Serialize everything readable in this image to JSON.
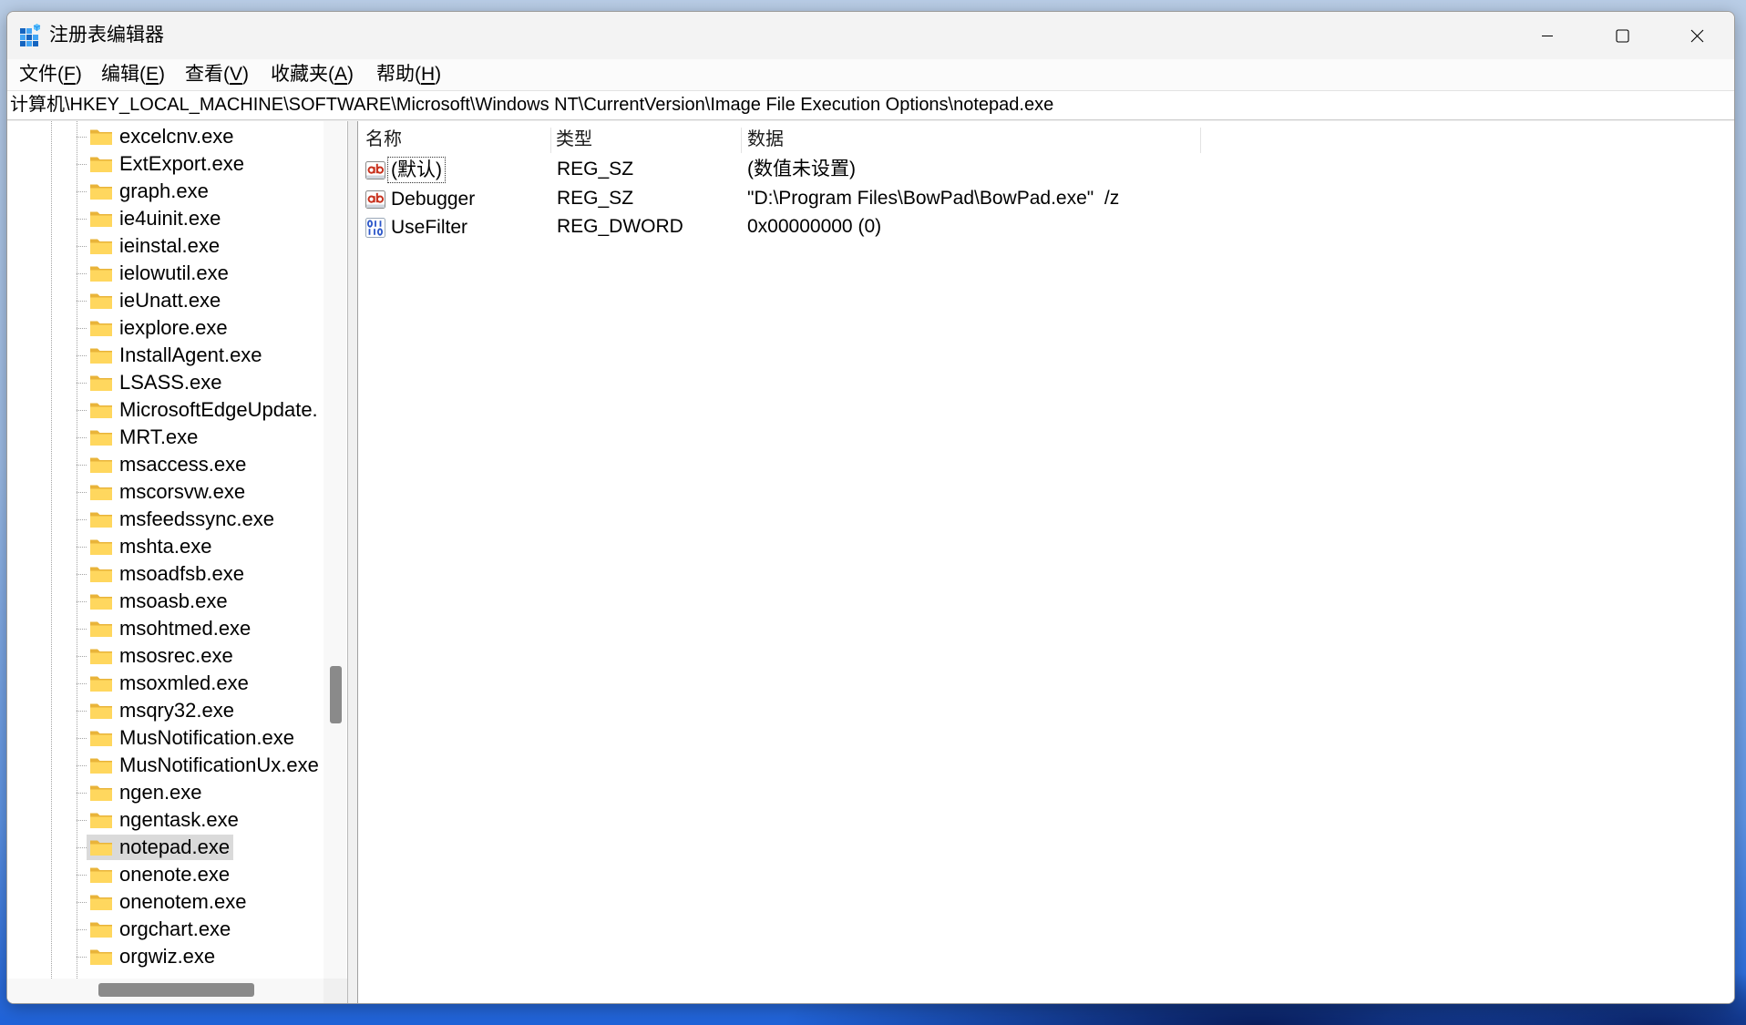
{
  "window": {
    "title": "注册表编辑器"
  },
  "menu": [
    {
      "prefix": "文件(",
      "key": "F",
      "suffix": ")"
    },
    {
      "prefix": "编辑(",
      "key": "E",
      "suffix": ")"
    },
    {
      "prefix": "查看(",
      "key": "V",
      "suffix": ")"
    },
    {
      "prefix": "收藏夹(",
      "key": "A",
      "suffix": ")"
    },
    {
      "prefix": "帮助(",
      "key": "H",
      "suffix": ")"
    }
  ],
  "address": {
    "path": "计算机\\HKEY_LOCAL_MACHINE\\SOFTWARE\\Microsoft\\Windows NT\\CurrentVersion\\Image File Execution Options\\notepad.exe"
  },
  "tree": {
    "items": [
      {
        "label": "excelcnv.exe"
      },
      {
        "label": "ExtExport.exe"
      },
      {
        "label": "graph.exe"
      },
      {
        "label": "ie4uinit.exe"
      },
      {
        "label": "ieinstal.exe"
      },
      {
        "label": "ielowutil.exe"
      },
      {
        "label": "ieUnatt.exe"
      },
      {
        "label": "iexplore.exe"
      },
      {
        "label": "InstallAgent.exe"
      },
      {
        "label": "LSASS.exe"
      },
      {
        "label": "MicrosoftEdgeUpdate."
      },
      {
        "label": "MRT.exe"
      },
      {
        "label": "msaccess.exe"
      },
      {
        "label": "mscorsvw.exe"
      },
      {
        "label": "msfeedssync.exe"
      },
      {
        "label": "mshta.exe"
      },
      {
        "label": "msoadfsb.exe"
      },
      {
        "label": "msoasb.exe"
      },
      {
        "label": "msohtmed.exe"
      },
      {
        "label": "msosrec.exe"
      },
      {
        "label": "msoxmled.exe"
      },
      {
        "label": "msqry32.exe"
      },
      {
        "label": "MusNotification.exe"
      },
      {
        "label": "MusNotificationUx.exe"
      },
      {
        "label": "ngen.exe"
      },
      {
        "label": "ngentask.exe"
      },
      {
        "label": "notepad.exe",
        "selected": true
      },
      {
        "label": "onenote.exe"
      },
      {
        "label": "onenotem.exe"
      },
      {
        "label": "orgchart.exe"
      },
      {
        "label": "orgwiz.exe"
      }
    ]
  },
  "list": {
    "columns": {
      "name": "名称",
      "type": "类型",
      "data": "数据"
    },
    "rows": [
      {
        "icon": "string-value-icon",
        "name": "(默认)",
        "type": "REG_SZ",
        "data": "(数值未设置)",
        "focused": true
      },
      {
        "icon": "string-value-icon",
        "name": "Debugger",
        "type": "REG_SZ",
        "data": "\"D:\\Program Files\\BowPad\\BowPad.exe\"  /z"
      },
      {
        "icon": "binary-value-icon",
        "name": "UseFilter",
        "type": "REG_DWORD",
        "data": "0x00000000 (0)"
      }
    ]
  },
  "icons": {
    "app": "registry-editor-icon",
    "tree_node": "folder-icon",
    "minimize": "minimize-icon",
    "maximize": "maximize-icon",
    "close": "close-icon"
  },
  "colors": {
    "selection": "#dadada",
    "folder": "#ffd75e",
    "folder_tab": "#e9b43a",
    "string_icon": "#c8321e",
    "binary_icon": "#2a55c9",
    "app_icon": "#1565c0"
  }
}
